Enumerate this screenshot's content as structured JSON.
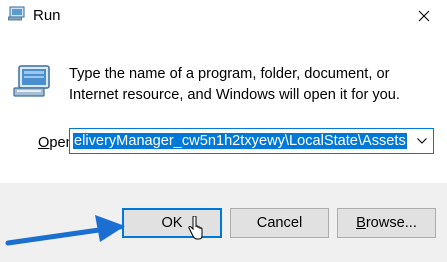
{
  "window": {
    "title": "Run",
    "close_glyph": "✕",
    "icon": "run-icon"
  },
  "dialog": {
    "description": "Type the name of a program, folder, document, or Internet resource, and Windows will open it for you.",
    "open_label_accel": "O",
    "open_label_rest": "pen:",
    "open_value": "eliveryManager_cw5n1h2txyewy\\LocalState\\Assets"
  },
  "buttons": {
    "ok_label": "OK",
    "cancel_label": "Cancel",
    "browse_accel": "B",
    "browse_rest": "rowse..."
  },
  "colors": {
    "accent": "#0078d7",
    "footer_bg": "#f0f0f0",
    "button_bg": "#e1e1e1",
    "annotation_arrow": "#1a6fd1"
  }
}
